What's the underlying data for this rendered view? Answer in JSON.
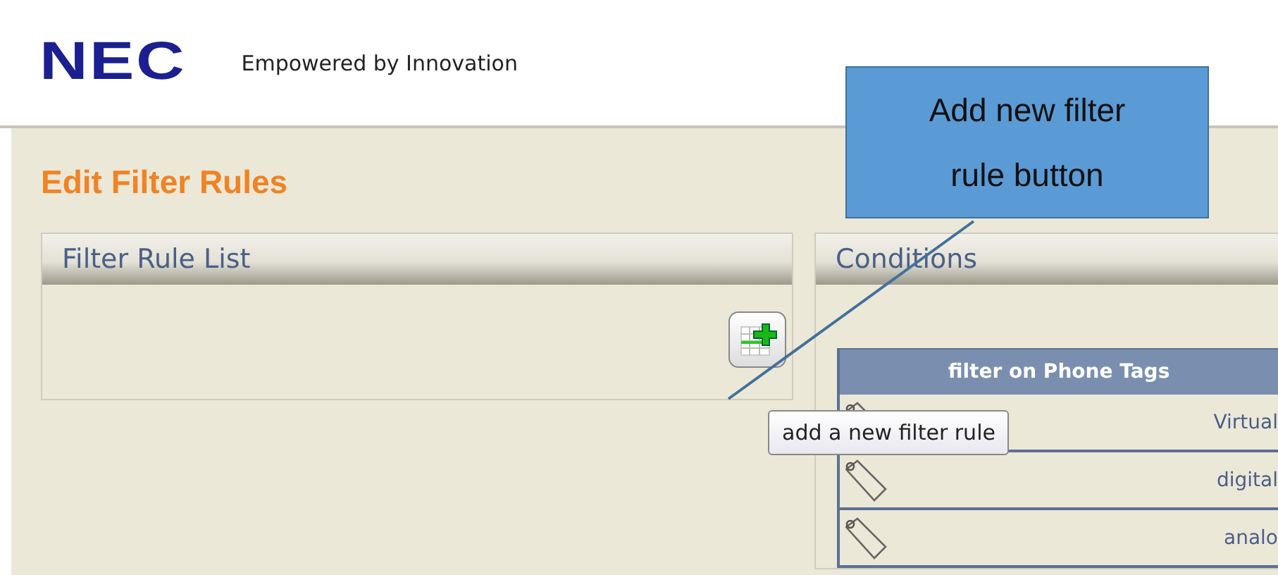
{
  "header": {
    "logo": "NEC",
    "tagline": "Empowered by Innovation"
  },
  "page_title": "Edit Filter Rules",
  "filter_rule_list": {
    "title": "Filter Rule List",
    "add_button_tooltip": "add a new filter rule"
  },
  "conditions": {
    "title": "Conditions",
    "table": {
      "header": "filter on Phone Tags",
      "rows": [
        {
          "label": "Virtual"
        },
        {
          "label": "digital"
        },
        {
          "label": "analo"
        }
      ]
    }
  },
  "callout": {
    "text": "Add new filter rule button"
  }
}
